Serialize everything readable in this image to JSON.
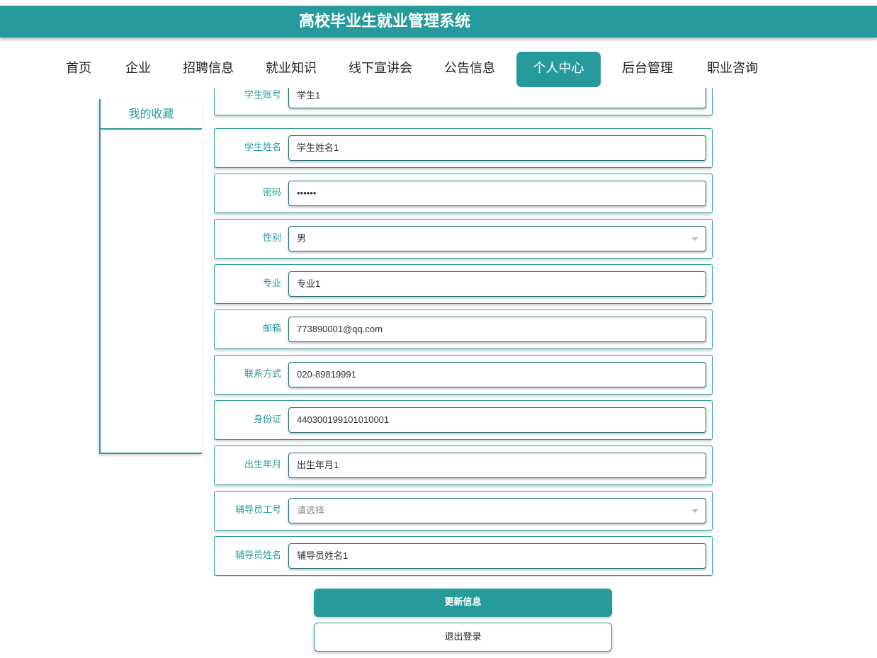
{
  "header": {
    "title": "高校毕业生就业管理系统"
  },
  "nav": {
    "items": [
      {
        "label": "首页"
      },
      {
        "label": "企业"
      },
      {
        "label": "招聘信息"
      },
      {
        "label": "就业知识"
      },
      {
        "label": "线下宣讲会"
      },
      {
        "label": "公告信息"
      },
      {
        "label": "个人中心",
        "active": true
      },
      {
        "label": "后台管理"
      },
      {
        "label": "职业咨询"
      }
    ]
  },
  "sidebar": {
    "items": [
      {
        "label": "我的收藏"
      }
    ]
  },
  "form": {
    "fields": [
      {
        "label": "学生账号",
        "value": "学生1"
      },
      {
        "label": "学生姓名",
        "value": "学生姓名1"
      },
      {
        "label": "密码",
        "value": "••••••"
      },
      {
        "label": "性别",
        "value": "男",
        "type": "select"
      },
      {
        "label": "专业",
        "value": "专业1"
      },
      {
        "label": "邮箱",
        "value": "773890001@qq.com"
      },
      {
        "label": "联系方式",
        "value": "020-89819991"
      },
      {
        "label": "身份证",
        "value": "440300199101010001"
      },
      {
        "label": "出生年月",
        "value": "出生年月1"
      },
      {
        "label": "辅导员工号",
        "placeholder": "请选择",
        "type": "select"
      },
      {
        "label": "辅导员姓名",
        "value": "辅导员姓名1"
      }
    ]
  },
  "actions": {
    "update_label": "更新信息",
    "logout_label": "退出登录"
  },
  "colors": {
    "accent": "#279b9c",
    "input_border": "#1a6f70"
  }
}
